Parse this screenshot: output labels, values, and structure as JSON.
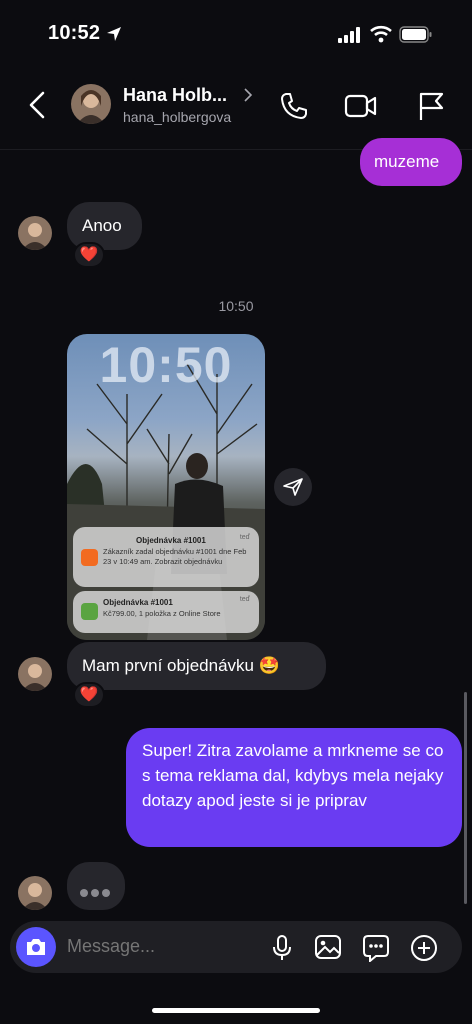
{
  "status_bar": {
    "time": "10:52"
  },
  "header": {
    "name": "Hana Holb...",
    "username": "hana_holbergova"
  },
  "messages": {
    "out_1": "muzeme",
    "in_1": "Anoo",
    "in_1_reaction": "❤️",
    "timestamp": "10:50",
    "image": {
      "lock_time": "10:50",
      "notif1": {
        "title": "Objednávka #1001",
        "body": "Zákazník zadal objednávku #1001 dne Feb 23 v 10:49 am. Zobrazit objednávku",
        "time": "teď"
      },
      "notif2": {
        "title": "Objednávka #1001",
        "body": "Kč799.00, 1 položka z Online Store",
        "time": "teď"
      }
    },
    "in_2": "Mam první objednávku 🤩",
    "in_2_reaction": "❤️",
    "out_2": "Super! Zitra zavolame a mrkneme se co s tema reklama dal, kdybys mela nejaky dotazy apod jeste si je priprav"
  },
  "composer": {
    "placeholder": "Message..."
  },
  "colors": {
    "outgoing_purple": "#a62fd6",
    "outgoing_violet": "#6a3cf2",
    "incoming": "#26262c",
    "camera_button": "#5b55ff"
  }
}
